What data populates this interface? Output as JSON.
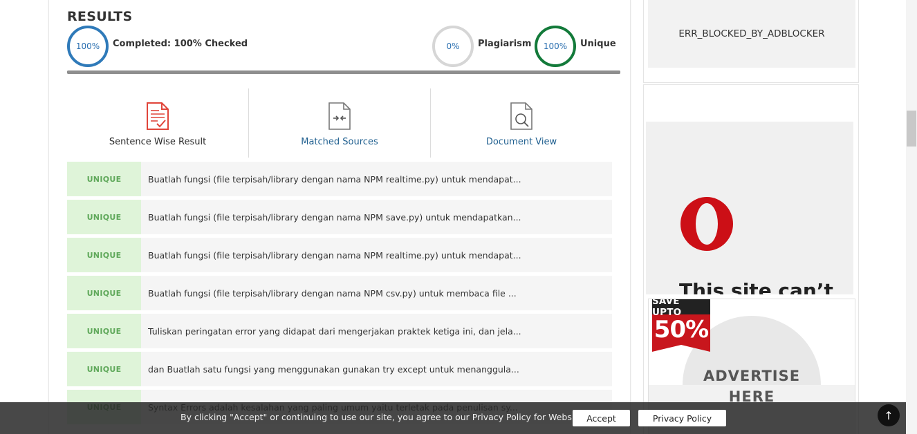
{
  "results": {
    "title": "RESULTS",
    "completed": {
      "percent_label": "100%",
      "label": "Completed: 100% Checked",
      "progress": 1.0
    },
    "plagiarism": {
      "percent_label": "0%",
      "label": "Plagiarism"
    },
    "unique": {
      "percent_label": "100%",
      "label": "Unique"
    }
  },
  "tabs": [
    {
      "label": "Sentence Wise Result",
      "icon": "document-check-icon",
      "active": true
    },
    {
      "label": "Matched Sources",
      "icon": "compare-file-icon",
      "active": false
    },
    {
      "label": "Document View",
      "icon": "document-search-icon",
      "active": false
    }
  ],
  "rows": [
    {
      "status": "UNIQUE",
      "text": "Buatlah fungsi (file terpisah/library dengan nama NPM realtime.py) untuk mendapat..."
    },
    {
      "status": "UNIQUE",
      "text": "Buatlah fungsi (file terpisah/library dengan nama NPM save.py) untuk mendapatkan..."
    },
    {
      "status": "UNIQUE",
      "text": "Buatlah fungsi (file terpisah/library dengan nama NPM realtime.py) untuk mendapat..."
    },
    {
      "status": "UNIQUE",
      "text": "Buatlah fungsi (file terpisah/library dengan nama NPM csv.py) untuk membaca file ..."
    },
    {
      "status": "UNIQUE",
      "text": "Tuliskan peringatan error yang didapat dari mengerjakan praktek ketiga ini, dan jela..."
    },
    {
      "status": "UNIQUE",
      "text": "dan Buatlah satu fungsi yang menggunakan gunakan try except untuk menanggula..."
    },
    {
      "status": "UNIQUE",
      "text": "Syntax Errors adalah kesalahan yang paling umum yaitu terletak pada penulisan sy..."
    }
  ],
  "sidebar": {
    "ad_error": "ERR_BLOCKED_BY_ADBLOCKER",
    "opera_text": "This site can’t",
    "save_badge_top": "SAVE UPTO",
    "save_badge_value": "50%",
    "advertise_line1": "ADVERTISE",
    "advertise_line2": "HERE"
  },
  "cookie": {
    "text": "By clicking \"Accept\" or continuing to use our site, you agree to our Privacy Policy for Website",
    "accept_label": "Accept",
    "privacy_label": "Privacy Policy"
  },
  "to_top_label": "↑",
  "colors": {
    "completed_ring": "#2f7ab9",
    "plagiarism_ring": "#d6d6d6",
    "unique_ring": "#137a3a",
    "unique_badge_bg": "#dff4d9",
    "unique_badge_text": "#5fa85a",
    "link": "#1f5f8f",
    "opera_red": "#cc0f16"
  }
}
